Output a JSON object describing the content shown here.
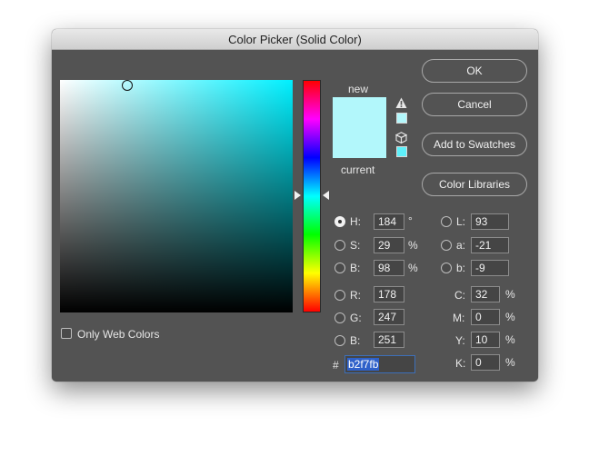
{
  "window": {
    "title": "Color Picker (Solid Color)"
  },
  "preview": {
    "new_label": "new",
    "current_label": "current",
    "new_color": "#b2f7fb",
    "current_color": "#b2f7fb"
  },
  "buttons": {
    "ok": "OK",
    "cancel": "Cancel",
    "add_swatches": "Add to Swatches",
    "libraries": "Color Libraries"
  },
  "hsb": [
    {
      "label": "H:",
      "value": "184",
      "unit": "°",
      "selected": true
    },
    {
      "label": "S:",
      "value": "29",
      "unit": "%",
      "selected": false
    },
    {
      "label": "B:",
      "value": "98",
      "unit": "%",
      "selected": false
    }
  ],
  "rgb": [
    {
      "label": "R:",
      "value": "178"
    },
    {
      "label": "G:",
      "value": "247"
    },
    {
      "label": "B:",
      "value": "251"
    }
  ],
  "lab": [
    {
      "label": "L:",
      "value": "93"
    },
    {
      "label": "a:",
      "value": "-21"
    },
    {
      "label": "b:",
      "value": "-9"
    }
  ],
  "cmyk": [
    {
      "label": "C:",
      "value": "32",
      "unit": "%"
    },
    {
      "label": "M:",
      "value": "0",
      "unit": "%"
    },
    {
      "label": "Y:",
      "value": "10",
      "unit": "%"
    },
    {
      "label": "K:",
      "value": "0",
      "unit": "%"
    }
  ],
  "hex": {
    "prefix": "#",
    "value": "b2f7fb"
  },
  "web_colors": {
    "label": "Only Web Colors",
    "checked": false
  },
  "colors": {
    "hue_base": "#00f0ff",
    "accent": "#2f61c9"
  }
}
